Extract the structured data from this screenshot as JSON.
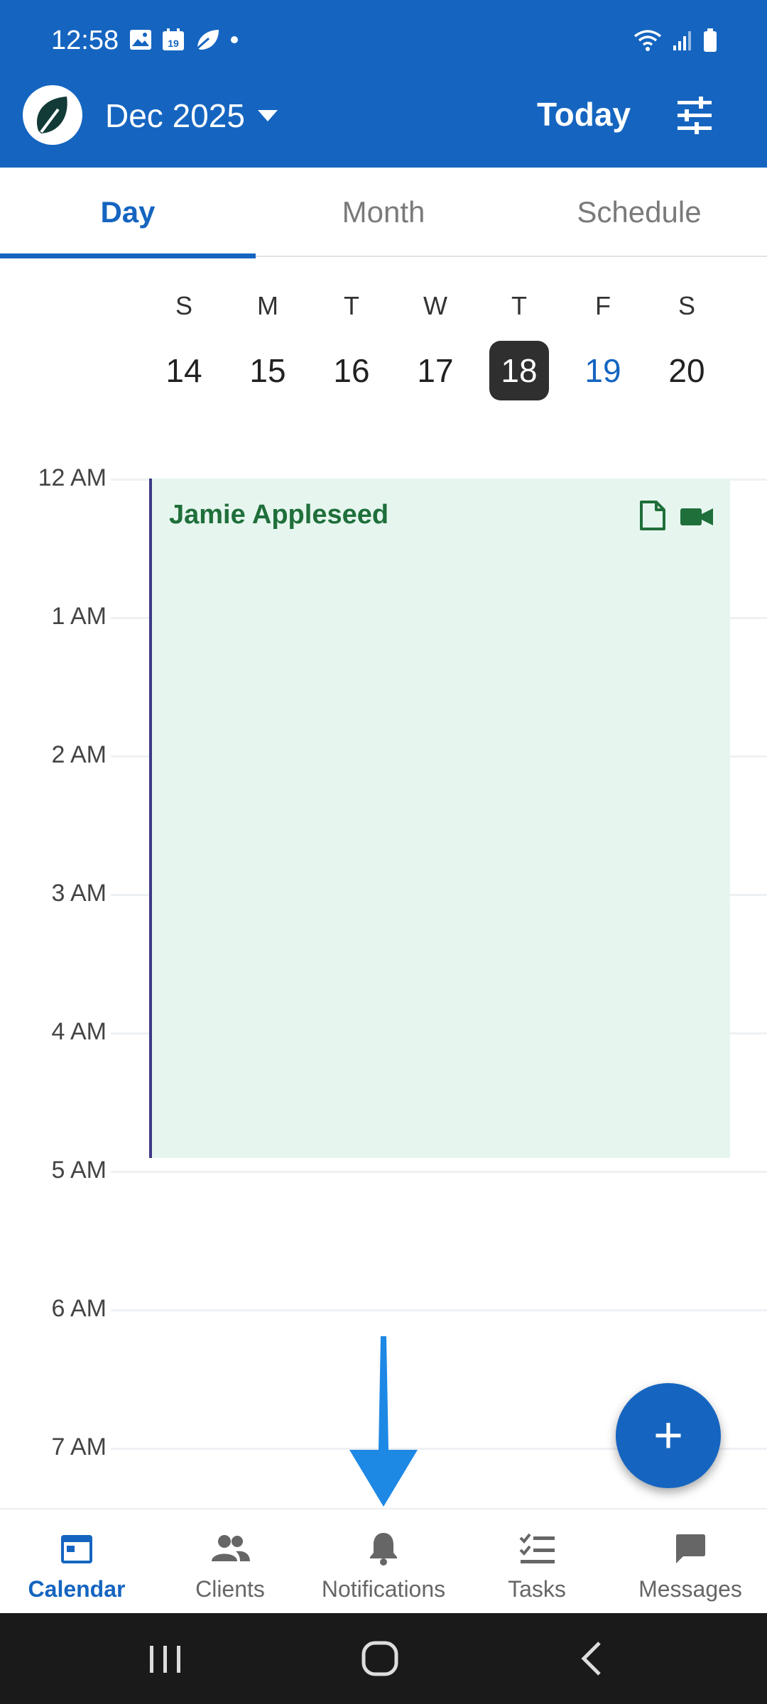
{
  "status_bar": {
    "time": "12:58",
    "left_icons": [
      "image-icon",
      "calendar-19-icon",
      "leaf-icon",
      "dot-icon"
    ],
    "right_icons": [
      "wifi-icon",
      "signal-icon",
      "battery-icon"
    ]
  },
  "app_bar": {
    "month_title": "Dec 2025",
    "today_label": "Today",
    "logo_icon": "app-logo-icon",
    "filter_icon": "tune-icon"
  },
  "tabs": [
    {
      "label": "Day",
      "active": true
    },
    {
      "label": "Month",
      "active": false
    },
    {
      "label": "Schedule",
      "active": false
    }
  ],
  "week": {
    "days": [
      {
        "letter": "S",
        "date": "14"
      },
      {
        "letter": "M",
        "date": "15"
      },
      {
        "letter": "T",
        "date": "16"
      },
      {
        "letter": "W",
        "date": "17"
      },
      {
        "letter": "T",
        "date": "18",
        "selected": true
      },
      {
        "letter": "F",
        "date": "19",
        "highlight": true
      },
      {
        "letter": "S",
        "date": "20"
      }
    ]
  },
  "timeline": {
    "hours": [
      "12 AM",
      "1 AM",
      "2 AM",
      "3 AM",
      "4 AM",
      "5 AM",
      "6 AM",
      "7 AM"
    ]
  },
  "event": {
    "title": "Jamie Appleseed",
    "icons": [
      "document-icon",
      "video-camera-icon"
    ],
    "bg_color": "#e6f6ef",
    "title_color": "#1f6f3a"
  },
  "fab": {
    "label": "+"
  },
  "bottom_nav": [
    {
      "label": "Calendar",
      "icon": "calendar-icon",
      "active": true
    },
    {
      "label": "Clients",
      "icon": "people-icon",
      "active": false
    },
    {
      "label": "Notifications",
      "icon": "bell-icon",
      "active": false
    },
    {
      "label": "Tasks",
      "icon": "checklist-icon",
      "active": false
    },
    {
      "label": "Messages",
      "icon": "chat-icon",
      "active": false
    }
  ],
  "system_nav": [
    "recent-apps-icon",
    "home-icon",
    "back-icon"
  ],
  "colors": {
    "primary": "#1565c0",
    "selected_date_bg": "#2f2f2f",
    "annotation_arrow": "#1e88e5"
  }
}
